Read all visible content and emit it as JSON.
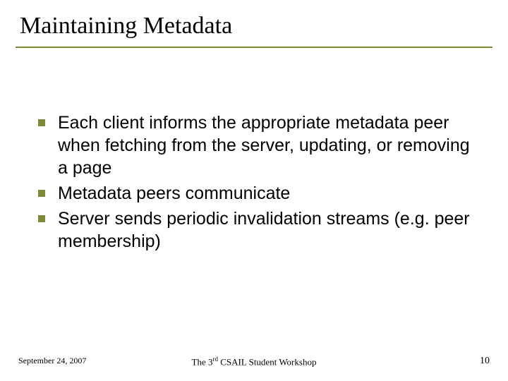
{
  "title": "Maintaining Metadata",
  "bullets": [
    "Each client informs the appropriate metadata peer when fetching from the server, updating, or removing a page",
    "Metadata peers communicate",
    "Server sends periodic invalidation streams (e.g. peer membership)"
  ],
  "footer": {
    "date": "September 24, 2007",
    "venue_prefix": "The 3",
    "venue_ordinal": "rd",
    "venue_suffix": " CSAIL Student Workshop",
    "page": "10"
  }
}
